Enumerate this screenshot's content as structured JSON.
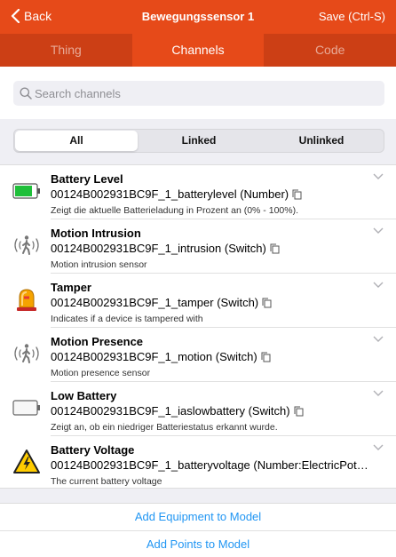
{
  "navbar": {
    "back_label": "Back",
    "title": "Bewegungssensor 1",
    "save_label": "Save (Ctrl-S)"
  },
  "tabs": [
    {
      "label": "Thing",
      "active": false
    },
    {
      "label": "Channels",
      "active": true
    },
    {
      "label": "Code",
      "active": false
    }
  ],
  "search": {
    "placeholder": "Search channels",
    "value": ""
  },
  "filter": {
    "options": [
      "All",
      "Linked",
      "Unlinked"
    ],
    "selected": "All"
  },
  "channels": [
    {
      "title": "Battery Level",
      "uid": "00124B002931BC9F_1_batterylevel (Number)",
      "description": "Zeigt die aktuelle Batterieladung in Prozent an (0% - 100%).",
      "icon": "battery-full-icon"
    },
    {
      "title": "Motion Intrusion",
      "uid": "00124B002931BC9F_1_intrusion (Switch)",
      "description": "Motion intrusion sensor",
      "icon": "motion-icon"
    },
    {
      "title": "Tamper",
      "uid": "00124B002931BC9F_1_tamper (Switch)",
      "description": "Indicates if a device is tampered with",
      "icon": "alarm-siren-icon"
    },
    {
      "title": "Motion Presence",
      "uid": "00124B002931BC9F_1_motion (Switch)",
      "description": "Motion presence sensor",
      "icon": "motion-icon"
    },
    {
      "title": "Low Battery",
      "uid": "00124B002931BC9F_1_iaslowbattery (Switch)",
      "description": "Zeigt an, ob ein niedriger Batteriestatus erkannt wurde.",
      "icon": "battery-empty-icon"
    },
    {
      "title": "Battery Voltage",
      "uid": "00124B002931BC9F_1_batteryvoltage (Number:ElectricPot…",
      "description": "The current battery voltage",
      "icon": "high-voltage-icon"
    }
  ],
  "footer": {
    "add_equipment_label": "Add Equipment to Model",
    "add_points_label": "Add Points to Model"
  },
  "colors": {
    "accent": "#e64a19",
    "link": "#2196f3"
  }
}
